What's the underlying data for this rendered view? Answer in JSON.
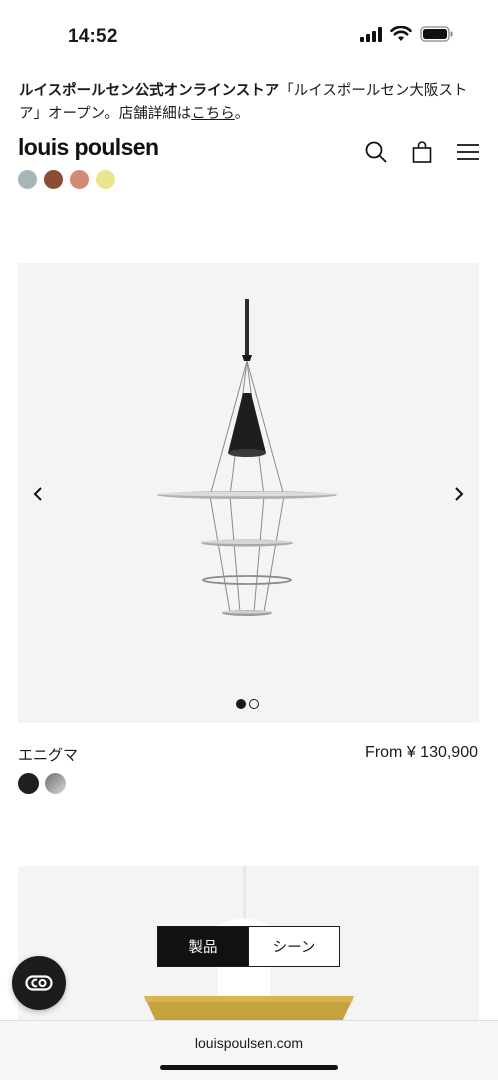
{
  "status_bar": {
    "time": "14:52"
  },
  "announcement": {
    "bold_text": "ルイスポールセン公式オンラインストア",
    "text": "「ルイスポールセン大阪ストア」オープン。店舗詳細は",
    "link_text": "こちら",
    "suffix": "。"
  },
  "header": {
    "logo": "louis poulsen",
    "icons": [
      "search-icon",
      "bag-icon",
      "menu-icon"
    ]
  },
  "top_swatches": [
    "#a9b3ba",
    "#8a4e36",
    "#d48a72",
    "#ece58e"
  ],
  "product": {
    "name": "エニグマ",
    "price": "From ¥ 130,900",
    "swatches": [
      "#1f1f1f",
      "#a6a6a6"
    ],
    "carousel": {
      "current": 1,
      "total": 2
    }
  },
  "toggle": {
    "product_label": "製品",
    "scene_label": "シーン",
    "active": "product"
  },
  "browser": {
    "url": "louispoulsen.com"
  },
  "colors": {
    "text": "#1a1a1a",
    "image_bg": "#f4f4f4",
    "brass": "#c6a23f"
  }
}
